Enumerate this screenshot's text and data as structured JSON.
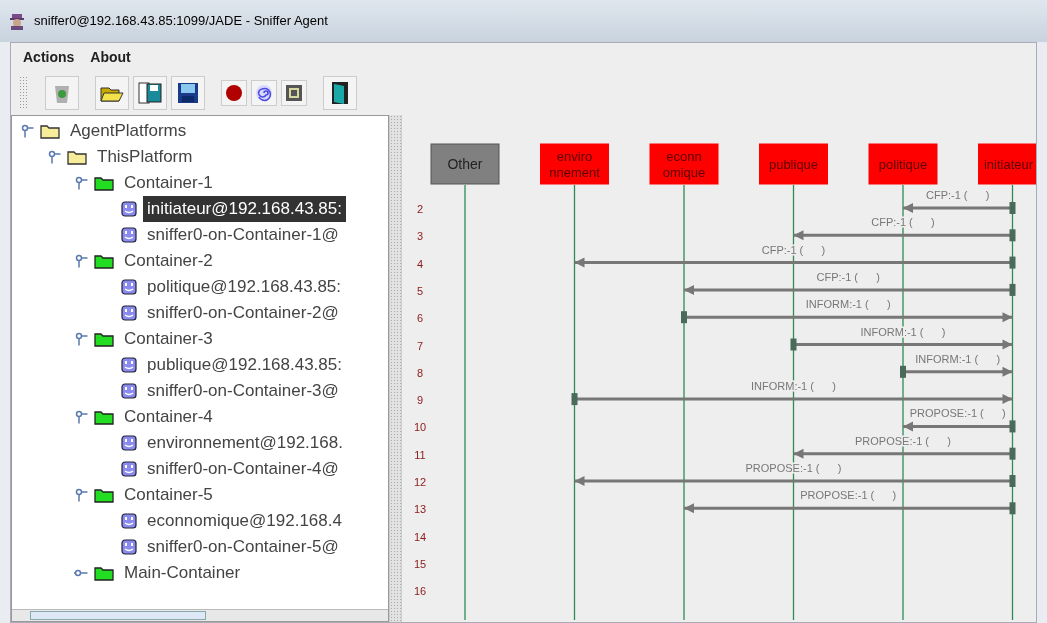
{
  "window": {
    "title": "sniffer0@192.168.43.85:1099/JADE - Sniffer Agent"
  },
  "menu": [
    "Actions",
    "About"
  ],
  "tree": [
    {
      "label": "AgentPlatforms",
      "kind": "platform",
      "expanded": true,
      "children": [
        {
          "label": "ThisPlatform",
          "kind": "platform",
          "expanded": true,
          "children": [
            {
              "label": "Container-1",
              "kind": "container",
              "expanded": true,
              "children": [
                {
                  "label": "initiateur@192.168.43.85:",
                  "kind": "agent",
                  "selected": true
                },
                {
                  "label": "sniffer0-on-Container-1@",
                  "kind": "agent",
                  "selected": false
                }
              ]
            },
            {
              "label": "Container-2",
              "kind": "container",
              "expanded": true,
              "children": [
                {
                  "label": "politique@192.168.43.85:",
                  "kind": "agent",
                  "selected": false
                },
                {
                  "label": "sniffer0-on-Container-2@",
                  "kind": "agent",
                  "selected": false
                }
              ]
            },
            {
              "label": "Container-3",
              "kind": "container",
              "expanded": true,
              "children": [
                {
                  "label": "publique@192.168.43.85:",
                  "kind": "agent",
                  "selected": false
                },
                {
                  "label": "sniffer0-on-Container-3@",
                  "kind": "agent",
                  "selected": false
                }
              ]
            },
            {
              "label": "Container-4",
              "kind": "container",
              "expanded": true,
              "children": [
                {
                  "label": "environnement@192.168.",
                  "kind": "agent",
                  "selected": false
                },
                {
                  "label": "sniffer0-on-Container-4@",
                  "kind": "agent",
                  "selected": false
                }
              ]
            },
            {
              "label": "Container-5",
              "kind": "container",
              "expanded": true,
              "children": [
                {
                  "label": "econnomique@192.168.4",
                  "kind": "agent",
                  "selected": false
                },
                {
                  "label": "sniffer0-on-Container-5@",
                  "kind": "agent",
                  "selected": false
                }
              ]
            },
            {
              "label": "Main-Container",
              "kind": "container",
              "expanded": false
            }
          ]
        }
      ]
    }
  ],
  "agents": [
    {
      "lines": [
        "Other"
      ],
      "color": "#808080"
    },
    {
      "lines": [
        "enviro",
        "nnement"
      ],
      "color": "#ff0000"
    },
    {
      "lines": [
        "econn",
        "omique"
      ],
      "color": "#ff0000"
    },
    {
      "lines": [
        "publique"
      ],
      "color": "#ff0000"
    },
    {
      "lines": [
        "politique"
      ],
      "color": "#ff0000"
    },
    {
      "lines": [
        "initiateur"
      ],
      "color": "#ff0000"
    }
  ],
  "rows": [
    {
      "number": "2",
      "message": {
        "label": "CFP:-1 (      )",
        "lanes": [
          {
            "kind": "idle"
          },
          {
            "kind": "idle"
          },
          {
            "kind": "idle"
          },
          {
            "kind": "idle"
          },
          {
            "kind": "receiver"
          },
          {
            "kind": "sender"
          }
        ]
      }
    },
    {
      "number": "3",
      "message": {
        "label": "CFP:-1 (      )",
        "lanes": [
          {
            "kind": "idle"
          },
          {
            "kind": "idle"
          },
          {
            "kind": "idle"
          },
          {
            "kind": "receiver"
          },
          {
            "kind": "idle"
          },
          {
            "kind": "sender"
          }
        ]
      }
    },
    {
      "number": "4",
      "message": {
        "label": "CFP:-1 (      )",
        "lanes": [
          {
            "kind": "idle"
          },
          {
            "kind": "receiver"
          },
          {
            "kind": "idle"
          },
          {
            "kind": "idle"
          },
          {
            "kind": "idle"
          },
          {
            "kind": "sender"
          }
        ]
      }
    },
    {
      "number": "5",
      "message": {
        "label": "CFP:-1 (      )",
        "lanes": [
          {
            "kind": "idle"
          },
          {
            "kind": "idle"
          },
          {
            "kind": "receiver"
          },
          {
            "kind": "idle"
          },
          {
            "kind": "idle"
          },
          {
            "kind": "sender"
          }
        ]
      }
    },
    {
      "number": "6",
      "message": {
        "label": "INFORM:-1 (      )",
        "lanes": [
          {
            "kind": "idle"
          },
          {
            "kind": "idle"
          },
          {
            "kind": "sender"
          },
          {
            "kind": "idle"
          },
          {
            "kind": "idle"
          },
          {
            "kind": "receiver"
          }
        ]
      }
    },
    {
      "number": "7",
      "message": {
        "label": "INFORM:-1 (      )",
        "lanes": [
          {
            "kind": "idle"
          },
          {
            "kind": "idle"
          },
          {
            "kind": "idle"
          },
          {
            "kind": "sender"
          },
          {
            "kind": "idle"
          },
          {
            "kind": "receiver"
          }
        ]
      }
    },
    {
      "number": "8",
      "message": {
        "label": "INFORM:-1 (      )",
        "lanes": [
          {
            "kind": "idle"
          },
          {
            "kind": "idle"
          },
          {
            "kind": "idle"
          },
          {
            "kind": "idle"
          },
          {
            "kind": "sender"
          },
          {
            "kind": "receiver"
          }
        ]
      }
    },
    {
      "number": "9",
      "message": {
        "label": "INFORM:-1 (      )",
        "lanes": [
          {
            "kind": "idle"
          },
          {
            "kind": "sender"
          },
          {
            "kind": "idle"
          },
          {
            "kind": "idle"
          },
          {
            "kind": "idle"
          },
          {
            "kind": "receiver"
          }
        ]
      }
    },
    {
      "number": "10",
      "message": {
        "label": "PROPOSE:-1 (      )",
        "lanes": [
          {
            "kind": "idle"
          },
          {
            "kind": "idle"
          },
          {
            "kind": "idle"
          },
          {
            "kind": "idle"
          },
          {
            "kind": "receiver"
          },
          {
            "kind": "sender"
          }
        ]
      }
    },
    {
      "number": "11",
      "message": {
        "label": "PROPOSE:-1 (      )",
        "lanes": [
          {
            "kind": "idle"
          },
          {
            "kind": "idle"
          },
          {
            "kind": "idle"
          },
          {
            "kind": "receiver"
          },
          {
            "kind": "idle"
          },
          {
            "kind": "sender"
          }
        ]
      }
    },
    {
      "number": "12",
      "message": {
        "label": "PROPOSE:-1 (      )",
        "lanes": [
          {
            "kind": "idle"
          },
          {
            "kind": "receiver"
          },
          {
            "kind": "idle"
          },
          {
            "kind": "idle"
          },
          {
            "kind": "idle"
          },
          {
            "kind": "sender"
          }
        ]
      }
    },
    {
      "number": "13",
      "message": {
        "label": "PROPOSE:-1 (      )",
        "lanes": [
          {
            "kind": "idle"
          },
          {
            "kind": "idle"
          },
          {
            "kind": "receiver"
          },
          {
            "kind": "idle"
          },
          {
            "kind": "idle"
          },
          {
            "kind": "sender"
          }
        ]
      }
    },
    {
      "number": "14"
    },
    {
      "number": "15"
    },
    {
      "number": "16"
    }
  ]
}
